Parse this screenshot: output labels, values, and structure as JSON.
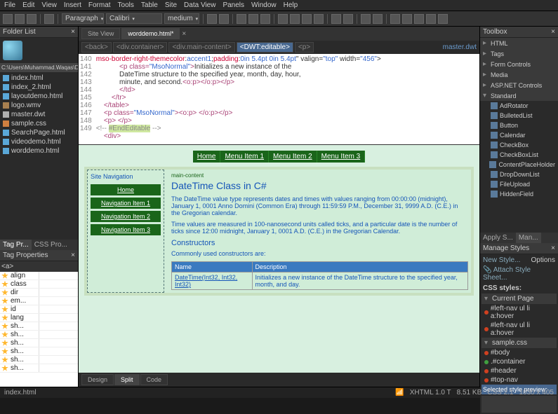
{
  "menu": {
    "file": "File",
    "edit": "Edit",
    "view": "View",
    "insert": "Insert",
    "format": "Format",
    "tools": "Tools",
    "table": "Table",
    "site": "Site",
    "dataview": "Data View",
    "panels": "Panels",
    "window": "Window",
    "help": "Help"
  },
  "toolbar": {
    "style": "Paragraph",
    "font": "Calibri",
    "size": "medium"
  },
  "folderPanel": {
    "title": "Folder List",
    "path": "C:\\Users\\Muhammad.Waqas\\Do"
  },
  "files": [
    {
      "n": "index.html",
      "t": "h"
    },
    {
      "n": "index_2.html",
      "t": "h"
    },
    {
      "n": "layoutdemo.html",
      "t": "h"
    },
    {
      "n": "logo.wmv",
      "t": "w"
    },
    {
      "n": "master.dwt",
      "t": "d"
    },
    {
      "n": "sample.css",
      "t": "c"
    },
    {
      "n": "SearchPage.html",
      "t": "h"
    },
    {
      "n": "videodemo.html",
      "t": "h"
    },
    {
      "n": "worddemo.html",
      "t": "h"
    }
  ],
  "tagTabs": {
    "a": "Tag Pr...",
    "b": "CSS Pro...",
    "attr": "<a>"
  },
  "tags": [
    {
      "n": "align"
    },
    {
      "n": "class"
    },
    {
      "n": "dir"
    },
    {
      "n": "em..."
    },
    {
      "n": "id"
    },
    {
      "n": "lang"
    },
    {
      "n": "sh..."
    },
    {
      "n": "sh..."
    },
    {
      "n": "sh..."
    },
    {
      "n": "sh..."
    },
    {
      "n": "sh..."
    },
    {
      "n": "sh..."
    }
  ],
  "centerTabs": {
    "a": "Site View",
    "b": "worddemo.html*"
  },
  "crumb": {
    "back": "<back>",
    "containers": [
      "<div.container>",
      "<div.main-content>",
      "<DWT:editable>",
      "<p>"
    ],
    "link": "master.dwt"
  },
  "code": {
    "nums": "140\n141\n142\n143\n144\n145\n146\n147\n148\n149",
    "text": "mso-border-right-themecolor:accent1;padding:0in 5.4pt 0in 5.4pt\" valign=\"top\" width=\"456\">\n            <p class=\"MsoNormal\">Initializes a new instance of the\n            DateTime structure to the specified year, month, day, hour,\n            minute, and second.<o:p></o:p></p>\n            </td>\n        </tr>\n    </table>\n    <p class=\"MsoNormal\"><o:p>&nbsp;</o:p></p>\n    <p>&nbsp;</p>\n<!-- #EndEditable -->\n    <div>"
  },
  "topmenu": {
    "home": "Home",
    "m1": "Menu Item 1",
    "m2": "Menu Item 2",
    "m3": "Menu Item 3"
  },
  "sidenav": {
    "title": "Site Navigation",
    "items": [
      "Home",
      "Navigation Item 1",
      "Navigation Item 2",
      "Navigation Item 3"
    ]
  },
  "content": {
    "label": "main-content",
    "title": "DateTime Class in C#",
    "p1": "The DateTime value type represents dates and times with values ranging from 00:00:00 (midnight), January 1, 0001 Anno Domini (Common Era) through 11:59:59 P.M., December 31, 9999 A.D. (C.E.) in the Gregorian calendar.",
    "p2": "Time values are measured in 100-nanosecond units called ticks, and a particular date is the number of ticks since 12:00 midnight, January 1, 0001 A.D. (C.E.) in the Gregorian Calendar.",
    "h3": "Constructors",
    "p3": "Commonly used constructors are:",
    "th1": "Name",
    "th2": "Description",
    "td1": "DateTime(Int32, Int32, Int32)",
    "td2": "Initializes a new instance of the DateTime structure to the specified year, month, and day."
  },
  "viewtabs": {
    "a": "Design",
    "b": "Split",
    "c": "Code"
  },
  "toolbox": {
    "title": "Toolbox",
    "groups": [
      "HTML",
      "Tags",
      "Form Controls",
      "Media",
      "ASP.NET Controls"
    ],
    "std": "Standard",
    "items": [
      "AdRotator",
      "BulletedList",
      "Button",
      "Calendar",
      "CheckBox",
      "CheckBoxList",
      "ContentPlaceHolder",
      "DropDownList",
      "FileUpload",
      "HiddenField"
    ]
  },
  "apply": {
    "t1": "Apply S...",
    "t2": "Man...",
    "newstyle": "New Style...",
    "options": "Options",
    "attach": "Attach Style Sheet...",
    "cssstyles": "CSS styles:",
    "current": "Current Page",
    "r1": "#left-nav ul li a:hover",
    "r2": "#left-nav ul li a:hover",
    "sample": "sample.css",
    "r3": "#body",
    "r4": ".#container",
    "r5": "#header",
    "r6": "#top-nav",
    "preview": "Selected style preview:"
  },
  "status": {
    "file": "index.html",
    "right": [
      "XHTML 1.0 T",
      "8.51 KB",
      "CSS 2.1",
      "1030 x 405"
    ]
  }
}
